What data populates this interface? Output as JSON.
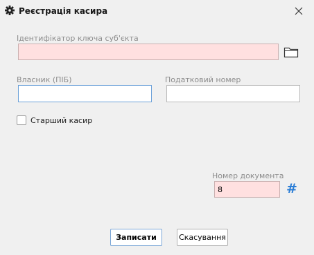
{
  "window": {
    "title": "Реєстрація касира"
  },
  "fields": {
    "key_id": {
      "label": "Ідентифікатор ключа суб'єкта",
      "value": ""
    },
    "owner": {
      "label": "Власник (ПІБ)",
      "value": ""
    },
    "tax_number": {
      "label": "Податковий номер",
      "value": ""
    },
    "doc_number": {
      "label": "Номер документа",
      "value": "8"
    }
  },
  "senior_cashier": {
    "label": "Старший касир",
    "checked": false
  },
  "generate_symbol": "#",
  "buttons": {
    "save": "Записати",
    "cancel": "Скасування"
  },
  "colors": {
    "required_bg": "#ffe0e0",
    "accent": "#2a7dd6"
  }
}
